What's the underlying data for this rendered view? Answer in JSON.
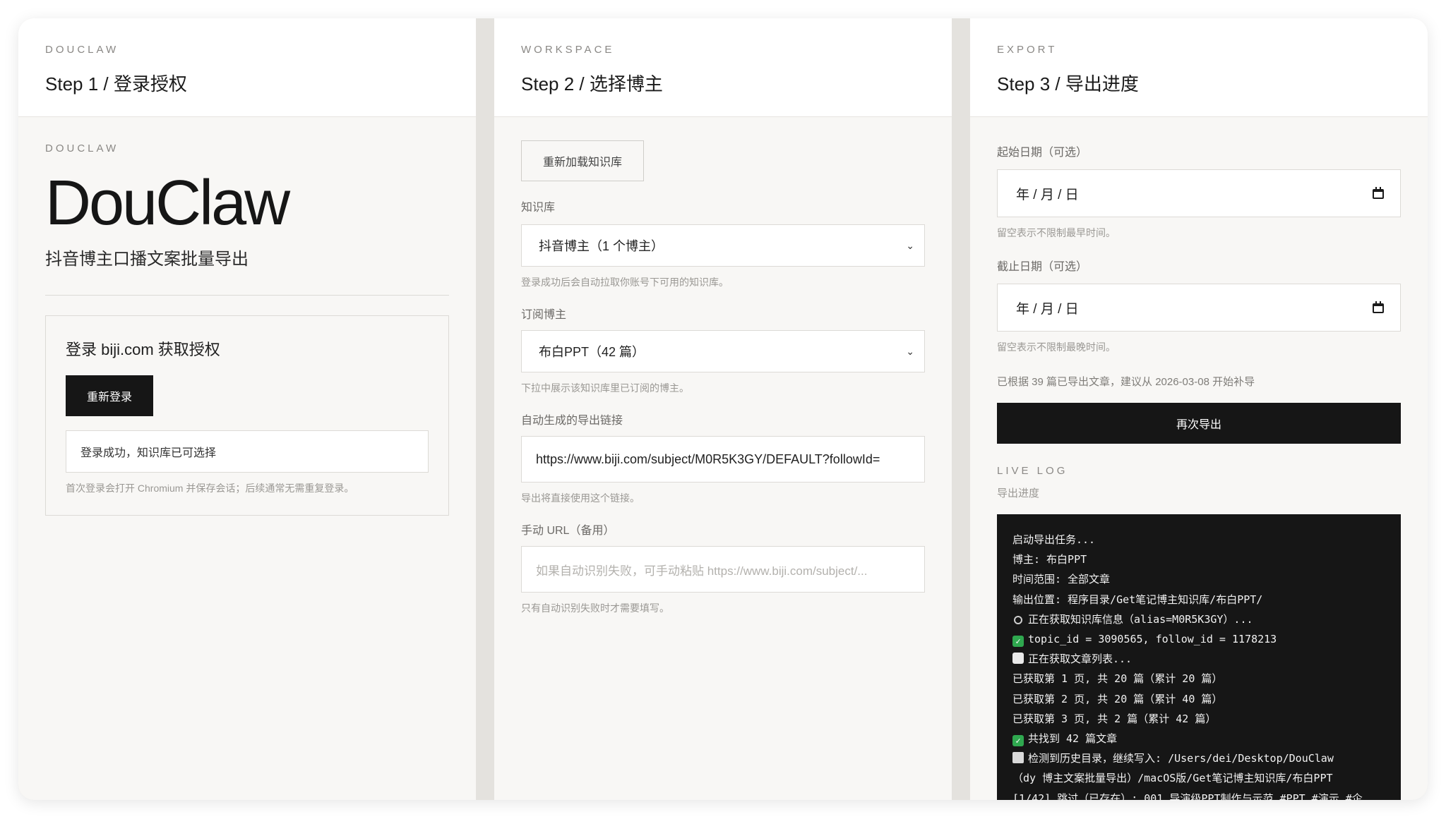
{
  "panel1": {
    "eyebrow": "DOUCLAW",
    "step_title": "Step 1 / 登录授权",
    "brand_eyebrow": "DOUCLAW",
    "brand_name": "DouClaw",
    "brand_subtitle": "抖音博主口播文案批量导出",
    "login_title": "登录 biji.com 获取授权",
    "relogin_label": "重新登录",
    "status_text": "登录成功，知识库已可选择",
    "hint": "首次登录会打开 Chromium 并保存会话；后续通常无需重复登录。"
  },
  "panel2": {
    "eyebrow": "WORKSPACE",
    "step_title": "Step 2 / 选择博主",
    "reload_label": "重新加载知识库",
    "kb_label": "知识库",
    "kb_value": "抖音博主（1 个博主）",
    "kb_hint": "登录成功后会自动拉取你账号下可用的知识库。",
    "blogger_label": "订阅博主",
    "blogger_value": "布白PPT（42 篇）",
    "blogger_hint": "下拉中展示该知识库里已订阅的博主。",
    "link_label": "自动生成的导出链接",
    "link_value": "https://www.biji.com/subject/M0R5K3GY/DEFAULT?followId=",
    "link_hint": "导出将直接使用这个链接。",
    "manual_label": "手动 URL（备用）",
    "manual_placeholder": "如果自动识别失败，可手动粘贴 https://www.biji.com/subject/...",
    "manual_hint": "只有自动识别失败时才需要填写。"
  },
  "panel3": {
    "eyebrow": "EXPORT",
    "step_title": "Step 3 / 导出进度",
    "start_label": "起始日期（可选）",
    "start_value": "年 / 月 / 日",
    "start_hint": "留空表示不限制最早时间。",
    "end_label": "截止日期（可选）",
    "end_value": "年 / 月 / 日",
    "end_hint": "留空表示不限制最晚时间。",
    "suggestion": "已根据 39 篇已导出文章，建议从 2026-03-08 开始补导",
    "export_label": "再次导出",
    "log_eyebrow": "LIVE LOG",
    "log_subtitle": "导出进度",
    "log_lines": [
      {
        "icon": "",
        "text": "启动导出任务..."
      },
      {
        "icon": "",
        "text": "博主: 布白PPT"
      },
      {
        "icon": "",
        "text": "时间范围: 全部文章"
      },
      {
        "icon": "",
        "text": "输出位置: 程序目录/Get笔记博主知识库/布白PPT/"
      },
      {
        "icon": "magnifier-icon",
        "text": "正在获取知识库信息（alias=M0R5K3GY）..."
      },
      {
        "icon": "check-icon",
        "text": "topic_id = 3090565, follow_id = 1178213"
      },
      {
        "icon": "document-icon",
        "text": "正在获取文章列表..."
      },
      {
        "icon": "",
        "text": "已获取第 1 页, 共 20 篇（累计 20 篇）"
      },
      {
        "icon": "",
        "text": "已获取第 2 页, 共 20 篇（累计 40 篇）"
      },
      {
        "icon": "",
        "text": "已获取第 3 页, 共 2 篇（累计 42 篇）"
      },
      {
        "icon": "check-icon",
        "text": "共找到 42 篇文章"
      },
      {
        "icon": "folder-icon",
        "text": "检测到历史目录，继续写入: /Users/dei/Desktop/DouClaw"
      },
      {
        "icon": "",
        "text": "（dy 博主文案批量导出）/macOS版/Get笔记博主知识库/布白PPT"
      },
      {
        "icon": "",
        "text": "[1/42] 跳过（已存在）: 001_导演级PPT制作与示范 #PPT #演示 #企"
      }
    ]
  }
}
